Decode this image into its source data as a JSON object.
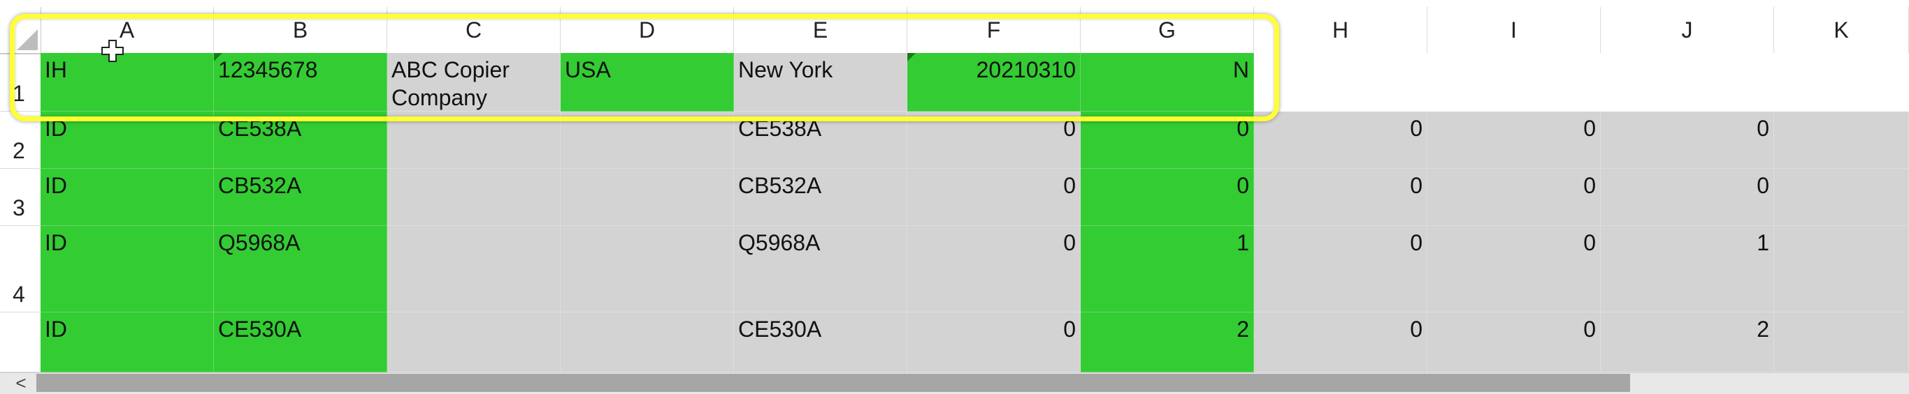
{
  "columns": [
    "A",
    "B",
    "C",
    "D",
    "E",
    "F",
    "G",
    "H",
    "I",
    "J",
    "K"
  ],
  "rows": [
    {
      "num": "1",
      "cells": [
        "IH",
        "12345678",
        "ABC Copier Company",
        "USA",
        "New York",
        "20210310",
        "N",
        "",
        "",
        "",
        ""
      ]
    },
    {
      "num": "2",
      "cells": [
        "ID",
        "CE538A",
        "",
        "",
        "CE538A",
        "0",
        "0",
        "0",
        "0",
        "0",
        ""
      ]
    },
    {
      "num": "3",
      "cells": [
        "ID",
        "CB532A",
        "",
        "",
        "CB532A",
        "0",
        "0",
        "0",
        "0",
        "0",
        ""
      ]
    },
    {
      "num": "4",
      "cells": [
        "ID",
        "Q5968A",
        "",
        "",
        "Q5968A",
        "0",
        "1",
        "0",
        "0",
        "1",
        ""
      ]
    },
    {
      "num": "",
      "cells": [
        "ID",
        "CE530A",
        "",
        "",
        "CE530A",
        "0",
        "2",
        "0",
        "0",
        "2",
        ""
      ]
    }
  ],
  "scroll_left_glyph": "<",
  "colors": {
    "green": "#33cc33",
    "gray": "#d3d3d3",
    "highlight": "#ffff33"
  }
}
